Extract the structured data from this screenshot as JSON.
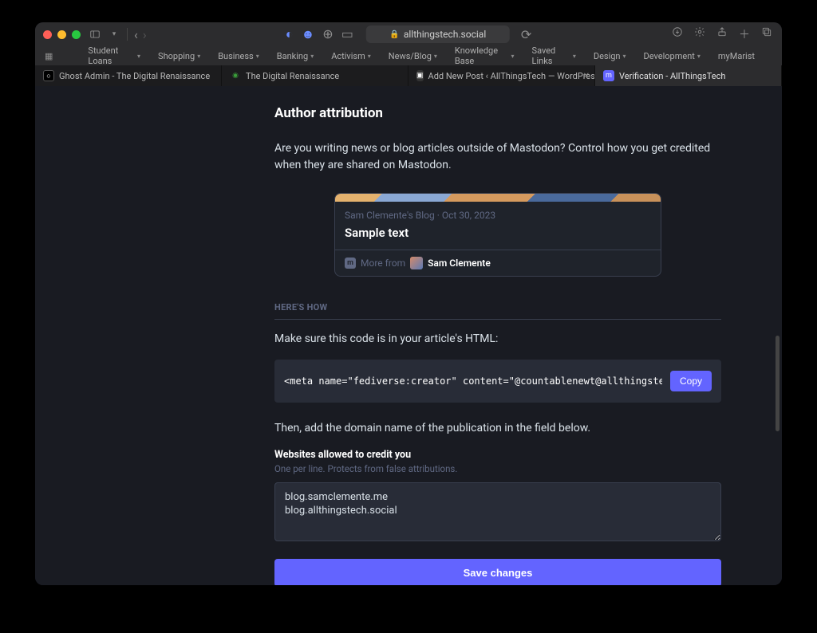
{
  "browser": {
    "url_display": "allthingstech.social",
    "bookmarks": [
      {
        "label": "Student Loans"
      },
      {
        "label": "Shopping"
      },
      {
        "label": "Business"
      },
      {
        "label": "Banking"
      },
      {
        "label": "Activism"
      },
      {
        "label": "News/Blog"
      },
      {
        "label": "Knowledge Base"
      },
      {
        "label": "Saved Links"
      },
      {
        "label": "Design"
      },
      {
        "label": "Development"
      },
      {
        "label": "myMarist"
      }
    ],
    "tabs": [
      {
        "title": "Ghost Admin - The Digital Renaissance",
        "active": false
      },
      {
        "title": "The Digital Renaissance",
        "active": false
      },
      {
        "title": "Add New Post ‹ AllThingsTech — WordPress",
        "active": false
      },
      {
        "title": "Verification - AllThingsTech",
        "active": true
      }
    ]
  },
  "page": {
    "title": "Author attribution",
    "lead": "Are you writing news or blog articles outside of Mastodon? Control how you get credited when they are shared on Mastodon.",
    "preview": {
      "meta_source": "Sam Clemente's Blog",
      "meta_date": "Oct 30, 2023",
      "sample_title": "Sample text",
      "more_from": "More from",
      "author": "Sam Clemente"
    },
    "how_header": "HERE'S HOW",
    "instruction1": "Make sure this code is in your article's HTML:",
    "code_snippet": "<meta name=\"fediverse:creator\" content=\"@countablenewt@allthingstech.social\">",
    "copy_label": "Copy",
    "instruction2": "Then, add the domain name of the publication in the field below.",
    "form": {
      "label": "Websites allowed to credit you",
      "hint": "One per line. Protects from false attributions.",
      "value": "blog.samclemente.me\nblog.allthingstech.social",
      "save_label": "Save changes"
    }
  }
}
